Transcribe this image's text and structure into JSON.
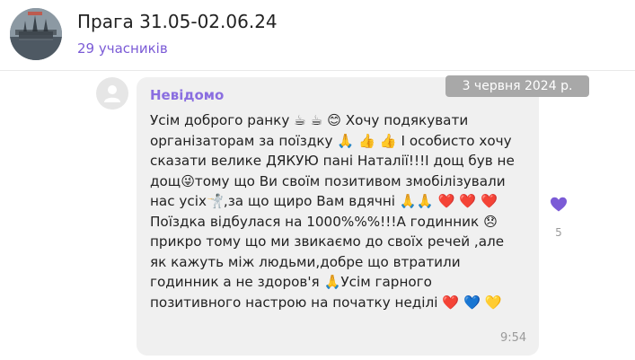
{
  "header": {
    "title": "Прага 31.05-02.06.24",
    "members": "29 учасників",
    "avatar_icon": "prague-photo"
  },
  "date_badge": "3 червня 2024 р.",
  "message": {
    "sender": "Невідомо",
    "lines": [
      "Усім доброго ранку ☕ ☕ 😊 Хочу подякувати",
      "організаторам за поїздку 🙏 👍 👍 І особисто хочу",
      "сказати велике ДЯКУЮ пані Наталії!!!І дощ був не",
      "дощ😜тому що Ви  своїм позитивом змобілізували",
      "нас усіх🤺,за що щиро Вам вдячні 🙏🙏 ❤️ ❤️ ❤️",
      "Поїздка відбулася на 1000%%%!!!А годинник 😞",
      "прикро тому що ми звикаємо до своїх речей ,але",
      "як кажуть між людьми,добре що втратили",
      "годинник а не здоров'я 🙏Усім гарного",
      "позитивного настрою на початку неділі  ❤️ 💙 💛"
    ],
    "time": "9:54",
    "reaction": {
      "icon": "purple-heart-icon",
      "count": "5",
      "color": "#7b5bd6"
    }
  },
  "colors": {
    "accent": "#7b5bd6",
    "sender": "#8a6ee0",
    "bubble": "#f0f0f0",
    "date_badge": "#a8a8a8"
  }
}
